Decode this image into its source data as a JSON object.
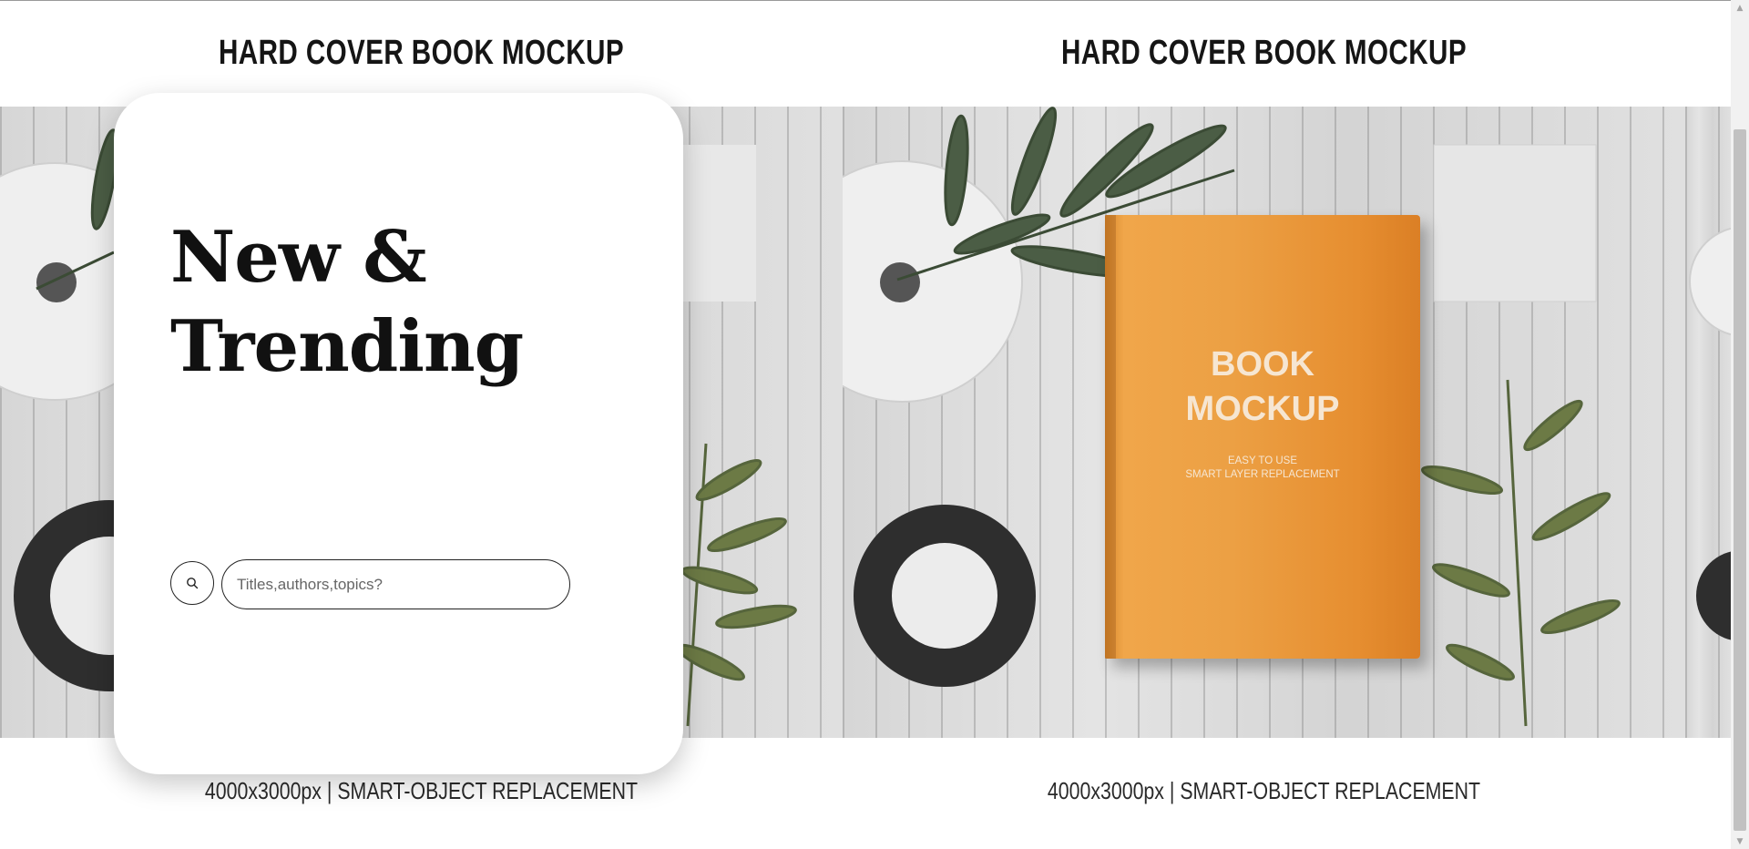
{
  "slides": [
    {
      "title": "HARD COVER BOOK MOCKUP",
      "caption": "4000x3000px | SMART-OBJECT REPLACEMENT"
    },
    {
      "title": "HARD COVER BOOK MOCKUP",
      "caption": "4000x3000px | SMART-OBJECT REPLACEMENT"
    }
  ],
  "book": {
    "title_line1": "BOOK",
    "title_line2": "MOCKUP",
    "sub_line1": "EASY TO USE",
    "sub_line2": "SMART LAYER REPLACEMENT",
    "color": "#ec9c40"
  },
  "hero": {
    "line1": "New &",
    "line2": "Trending"
  },
  "search": {
    "placeholder": "Titles,authors,topics?",
    "value": "",
    "icon": "search-icon"
  },
  "scrollbar": {
    "up_icon": "▲",
    "down_icon": "▼"
  }
}
